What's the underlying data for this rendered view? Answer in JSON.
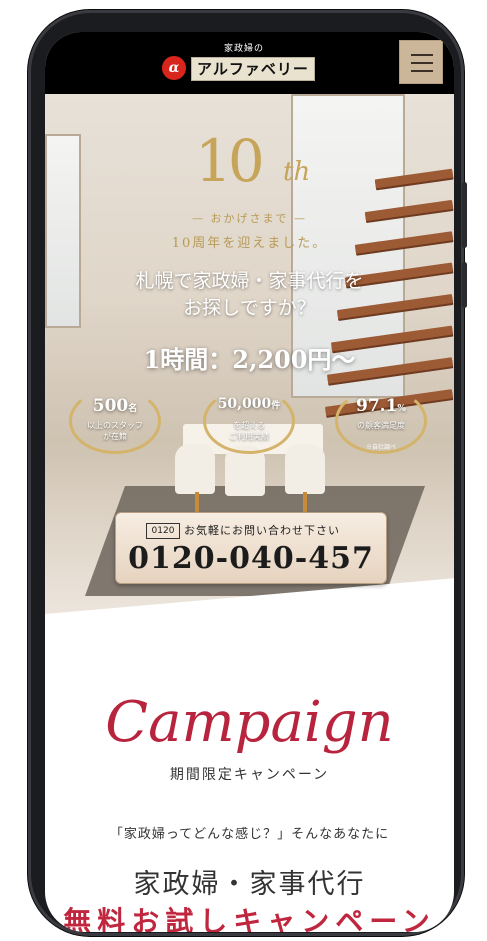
{
  "header": {
    "logo_small": "家政婦の",
    "logo_text": "アルファベリー",
    "menu_icon": "hamburger-icon"
  },
  "hero": {
    "ten": "10",
    "th": "th",
    "okage": "— おかげさまで —",
    "anniversary": "10周年を迎えました。",
    "headline_line1": "札幌で家政婦・家事代行を",
    "headline_line2": "お探しですか？",
    "price": "1時間：2,200円〜",
    "badges": [
      {
        "num": "500",
        "unit": "名",
        "sub1": "以上のスタッフ",
        "sub2": "が在籍",
        "note": ""
      },
      {
        "num": "50,000",
        "unit": "件",
        "sub1": "を超える",
        "sub2": "ご利用実績",
        "note": ""
      },
      {
        "num": "97.1",
        "unit": "%",
        "sub1": "の顧客満足度",
        "sub2": "",
        "note": "※自社調べ"
      }
    ],
    "cta": {
      "icon_label": "0120",
      "label": "お気軽にお問い合わせ下さい",
      "number": "0120-040-457"
    }
  },
  "campaign": {
    "title": "Campaign",
    "subtitle": "期間限定キャンペーン",
    "intro": "「家政婦ってどんな感じ？」そんなあなたに",
    "service": "家政婦・家事代行",
    "promo": "無料お試しキャンペーン"
  },
  "colors": {
    "gold": "#c6a45a",
    "accent_red": "#b8243d",
    "header_bg": "#000000",
    "menu_bg": "#cbb69a"
  }
}
